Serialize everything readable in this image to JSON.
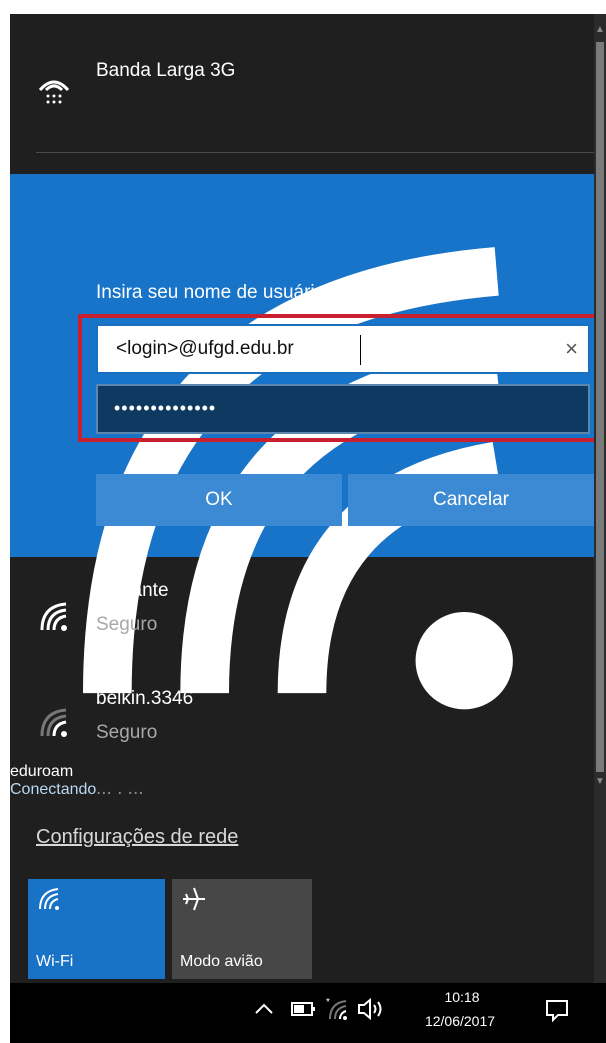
{
  "networks": {
    "broadband": {
      "name": "Banda Larga 3G",
      "icon": "cellular-modem-icon"
    },
    "selected": {
      "name": "eduroam",
      "status": "Conectando",
      "prompt": "Insira seu nome de usuário e senha",
      "username_value": "<login>@ufgd.edu.br",
      "password_value": "••••••••••••••",
      "clear_label": "×",
      "ok_label": "OK",
      "cancel_label": "Cancelar",
      "icon": "wifi-icon"
    },
    "list": [
      {
        "name": "Visitante",
        "status": "Seguro",
        "icon": "wifi-secure-icon"
      },
      {
        "name": "belkin.3346",
        "status": "Seguro",
        "icon": "wifi-weak-icon"
      }
    ],
    "partial_label": "...    .    ...    "
  },
  "settings_link": "Configurações de rede",
  "quick_actions": [
    {
      "label": "Wi-Fi",
      "icon": "wifi-icon",
      "active": true,
      "color": "#1872c6"
    },
    {
      "label": "Modo avião",
      "icon": "airplane-icon",
      "active": false,
      "color": "#474747"
    }
  ],
  "taskbar": {
    "time": "10:18",
    "date": "12/06/2017",
    "icons": [
      "chevron-up-icon",
      "battery-icon",
      "wifi-icon",
      "volume-icon",
      "notification-icon"
    ]
  },
  "colors": {
    "panel_bg": "#1f1f1f",
    "selected_bg": "#1874c9",
    "highlight_border": "#c8202e"
  }
}
